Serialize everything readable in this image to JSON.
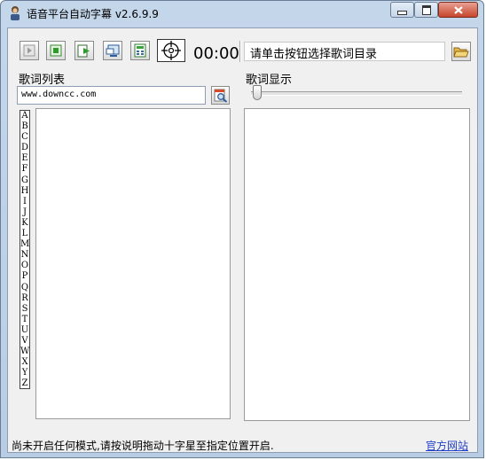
{
  "window": {
    "title": "语音平台自动字幕 v2.6.9.9",
    "controls": {
      "minimize_icon": "minimize-icon",
      "maximize_icon": "maximize-icon",
      "close_icon": "close-icon"
    }
  },
  "toolbar": {
    "buttons": [
      {
        "name": "play",
        "icon": "play-icon"
      },
      {
        "name": "stop",
        "icon": "stop-icon"
      },
      {
        "name": "export",
        "icon": "export-icon"
      },
      {
        "name": "monitor",
        "icon": "monitor-icon"
      },
      {
        "name": "calculator",
        "icon": "calculator-icon"
      },
      {
        "name": "crosshair",
        "icon": "crosshair-icon"
      }
    ],
    "time": "00:00",
    "status_text": "请单击按钮选择歌词目录",
    "folder_icon": "folder-open-icon"
  },
  "left_panel": {
    "label": "歌词列表",
    "url_value": "www.downcc.com",
    "search_icon": "search-icon",
    "alphabet": [
      "A",
      "B",
      "C",
      "D",
      "E",
      "F",
      "G",
      "H",
      "I",
      "J",
      "K",
      "L",
      "M",
      "N",
      "O",
      "P",
      "Q",
      "R",
      "S",
      "T",
      "U",
      "V",
      "W",
      "X",
      "Y",
      "Z"
    ]
  },
  "right_panel": {
    "label": "歌词显示",
    "slider_value": 0
  },
  "status_bar": {
    "message": "尚未开启任何模式,请按说明拖动十字星至指定位置开启.",
    "link": "官方网站"
  },
  "colors": {
    "title_bar": "#c4d6ea",
    "client_bg": "#f0f0f0",
    "link": "#1f3ec9",
    "close_button": "#c7452c"
  }
}
